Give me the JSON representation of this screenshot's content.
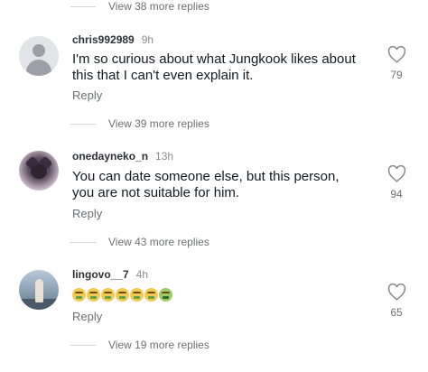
{
  "view_more": [
    {
      "label": "View 38 more replies"
    },
    {
      "label": "View 39 more replies"
    },
    {
      "label": "View 43 more replies"
    },
    {
      "label": "View 19 more replies"
    }
  ],
  "comments": [
    {
      "username": "chris992989",
      "time": "9h",
      "text": "I'm so curious about what Jungkook likes about this that I can't even explain it.",
      "reply_label": "Reply",
      "likes": "79"
    },
    {
      "username": "onedayneko_n",
      "time": "13h",
      "text": "You can date someone else, but this person, you are not suitable for him.",
      "reply_label": "Reply",
      "likes": "94"
    },
    {
      "username": "lingovo__7",
      "time": "4h",
      "emojis": [
        "nauseated-face-emoji",
        "nauseated-face-emoji",
        "nauseated-face-emoji",
        "nauseated-face-emoji",
        "nauseated-face-emoji",
        "nauseated-face-emoji",
        "nauseated-face-emoji"
      ],
      "reply_label": "Reply",
      "likes": "65"
    }
  ],
  "icons": {
    "like": "heart-outline-icon",
    "default_avatar": "default-user-avatar"
  }
}
